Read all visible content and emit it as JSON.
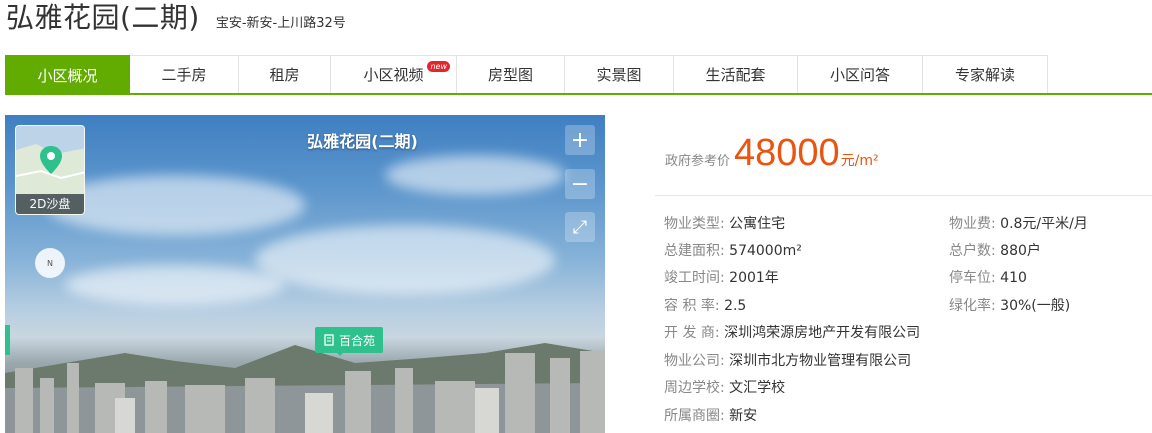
{
  "header": {
    "title": "弘雅花园(二期)",
    "address": "宝安-新安-上川路32号"
  },
  "tabs": [
    {
      "label": "小区概况",
      "active": true
    },
    {
      "label": "二手房"
    },
    {
      "label": "租房"
    },
    {
      "label": "小区视频",
      "badge": "new"
    },
    {
      "label": "房型图"
    },
    {
      "label": "实景图"
    },
    {
      "label": "生活配套"
    },
    {
      "label": "小区问答"
    },
    {
      "label": "专家解读"
    }
  ],
  "photo": {
    "title": "弘雅花园(二期)",
    "map_label": "2D沙盘",
    "poi_label": "百合苑",
    "compass_text": "N",
    "zoom_in": "+",
    "zoom_out": "−",
    "fullscreen": "⤢"
  },
  "price": {
    "label": "政府参考价",
    "value": "48000",
    "unit": "元/m²"
  },
  "info_left": [
    {
      "key": "物业类型:",
      "value": "公寓住宅"
    },
    {
      "key": "总建面积:",
      "value": "574000m²"
    },
    {
      "key": "竣工时间:",
      "value": "2001年"
    },
    {
      "key": "容 积 率:",
      "value": "2.5"
    },
    {
      "key": "开 发 商:",
      "value": "深圳鸿荣源房地产开发有限公司"
    },
    {
      "key": "物业公司:",
      "value": "深圳市北方物业管理有限公司"
    },
    {
      "key": "周边学校:",
      "value": "文汇学校"
    },
    {
      "key": "所属商圈:",
      "value": "新安"
    }
  ],
  "info_right": [
    {
      "key": "物业费:",
      "value": "0.8元/平米/月"
    },
    {
      "key": "总户数:",
      "value": "880户"
    },
    {
      "key": "停车位:",
      "value": "410"
    },
    {
      "key": "绿化率:",
      "value": "30%(一般)"
    }
  ],
  "colors": {
    "accent": "#62ab00",
    "price": "#e95410",
    "poi": "#2ec08d"
  }
}
